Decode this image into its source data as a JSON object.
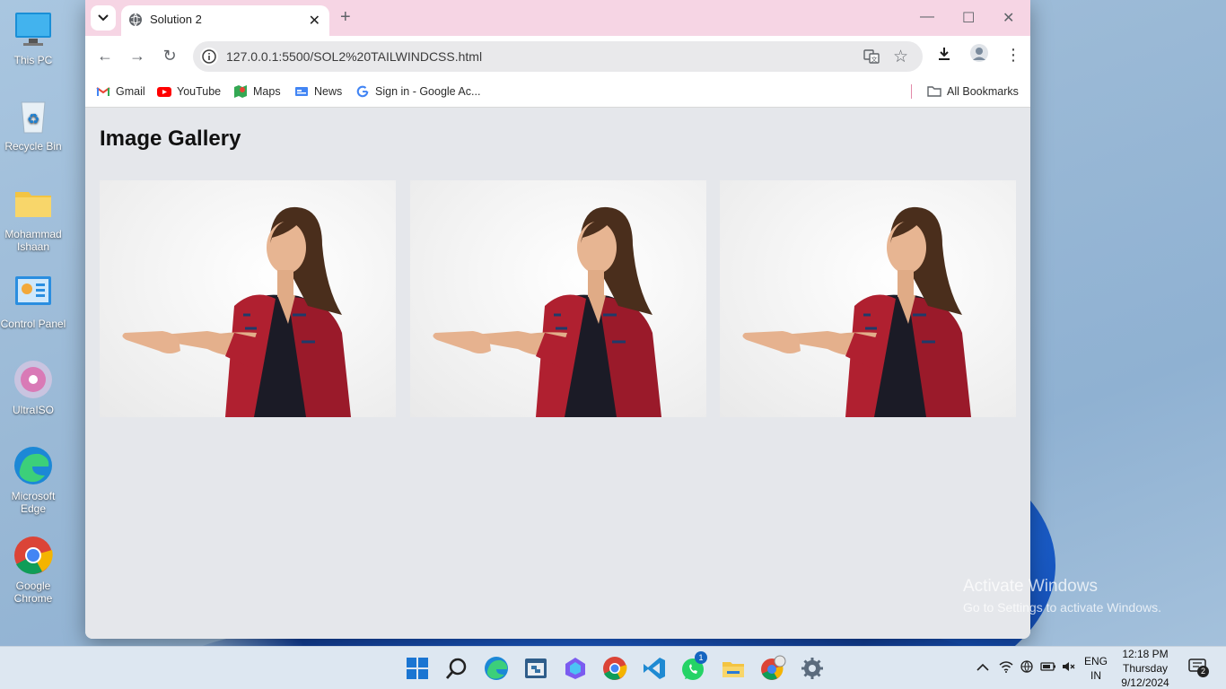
{
  "desktop": {
    "icons": [
      {
        "label": "This PC"
      },
      {
        "label": "Recycle Bin"
      },
      {
        "label": "Mohammad Ishaan"
      },
      {
        "label": "Control Panel"
      },
      {
        "label": "UltraISO"
      },
      {
        "label": "Microsoft Edge"
      },
      {
        "label": "Google Chrome"
      }
    ],
    "watermark": {
      "line1": "Activate Windows",
      "line2": "Go to Settings to activate Windows."
    }
  },
  "browser": {
    "tab": {
      "title": "Solution 2"
    },
    "address": {
      "url": "127.0.0.1:5500/SOL2%20TAILWINDCSS.html"
    },
    "bookmarks": [
      {
        "label": "Gmail",
        "icon": "gmail-icon"
      },
      {
        "label": "YouTube",
        "icon": "youtube-icon"
      },
      {
        "label": "Maps",
        "icon": "maps-icon"
      },
      {
        "label": "News",
        "icon": "news-icon"
      },
      {
        "label": "Sign in - Google Ac...",
        "icon": "google-icon"
      }
    ],
    "all_bookmarks": "All Bookmarks"
  },
  "page": {
    "title": "Image Gallery",
    "images": [
      {
        "name": "woman-pointing-photo-1"
      },
      {
        "name": "woman-pointing-photo-2"
      },
      {
        "name": "woman-pointing-photo-3"
      }
    ]
  },
  "taskbar": {
    "lang": {
      "line1": "ENG",
      "line2": "IN"
    },
    "clock": {
      "time": "12:18 PM",
      "day": "Thursday",
      "date": "9/12/2024"
    },
    "whatsapp_badge": "1",
    "notification_badge": "2"
  },
  "colors": {
    "tab_strip": "#f6d5e4",
    "page_bg": "#e5e7eb",
    "taskbar": "#dde7f1"
  }
}
